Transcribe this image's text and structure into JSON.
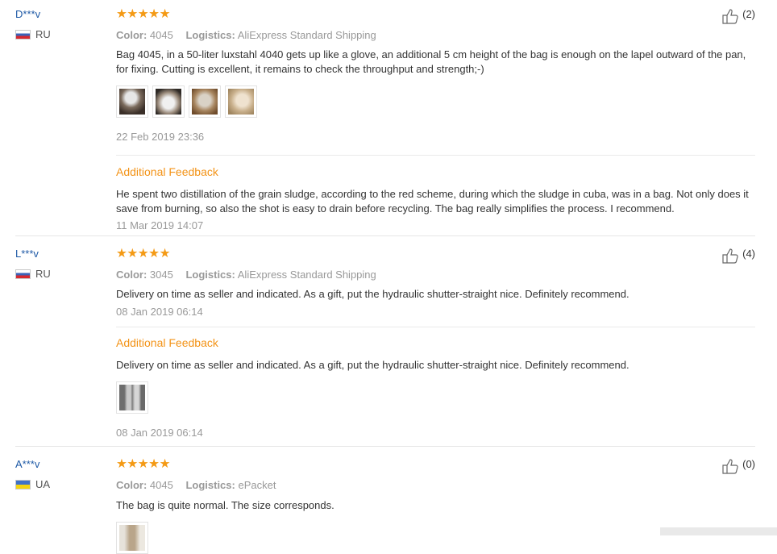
{
  "reviews": [
    {
      "user": "D***v",
      "country": "RU",
      "stars": "★★★★★",
      "color_label": "Color:",
      "color_value": "4045",
      "logistics_label": "Logistics:",
      "logistics_value": "AliExpress Standard Shipping",
      "text": "Bag 4045, in a 50-liter luxstahl 4040 gets up like a glove, an additional 5 cm height of the bag is enough on the lapel outward of the pan, for fixing. Cutting is excellent, it remains to check the throughput and strength;-)",
      "date": "22 Feb 2019 23:36",
      "likes": "(2)",
      "additional_label": "Additional Feedback",
      "additional_text": "He spent two distillation of the grain sludge, according to the red scheme, during which the sludge in cuba, was in a bag. Not only does it save from burning, so also the shot is easy to drain before recycling. The bag really simplifies the process. I recommend.",
      "additional_date": "11 Mar 2019 14:07"
    },
    {
      "user": "L***v",
      "country": "RU",
      "stars": "★★★★★",
      "color_label": "Color:",
      "color_value": "3045",
      "logistics_label": "Logistics:",
      "logistics_value": "AliExpress Standard Shipping",
      "text": "Delivery on time as seller and indicated. As a gift, put the hydraulic shutter-straight nice. Definitely recommend.",
      "date": "08 Jan 2019 06:14",
      "likes": "(4)",
      "additional_label": "Additional Feedback",
      "additional_text": "Delivery on time as seller and indicated. As a gift, put the hydraulic shutter-straight nice. Definitely recommend.",
      "additional_date": "08 Jan 2019 06:14"
    },
    {
      "user": "A***v",
      "country": "UA",
      "stars": "★★★★★",
      "color_label": "Color:",
      "color_value": "4045",
      "logistics_label": "Logistics:",
      "logistics_value": "ePacket",
      "text": "The bag is quite normal. The size corresponds.",
      "likes": "(0)"
    }
  ],
  "colors": {
    "accent": "#f39317",
    "link": "#1f5aa6",
    "star": "#f49a15"
  },
  "icons": {
    "like": "thumbs-up-icon",
    "flag_ru": "flag-ru-icon",
    "flag_ua": "flag-ua-icon"
  }
}
